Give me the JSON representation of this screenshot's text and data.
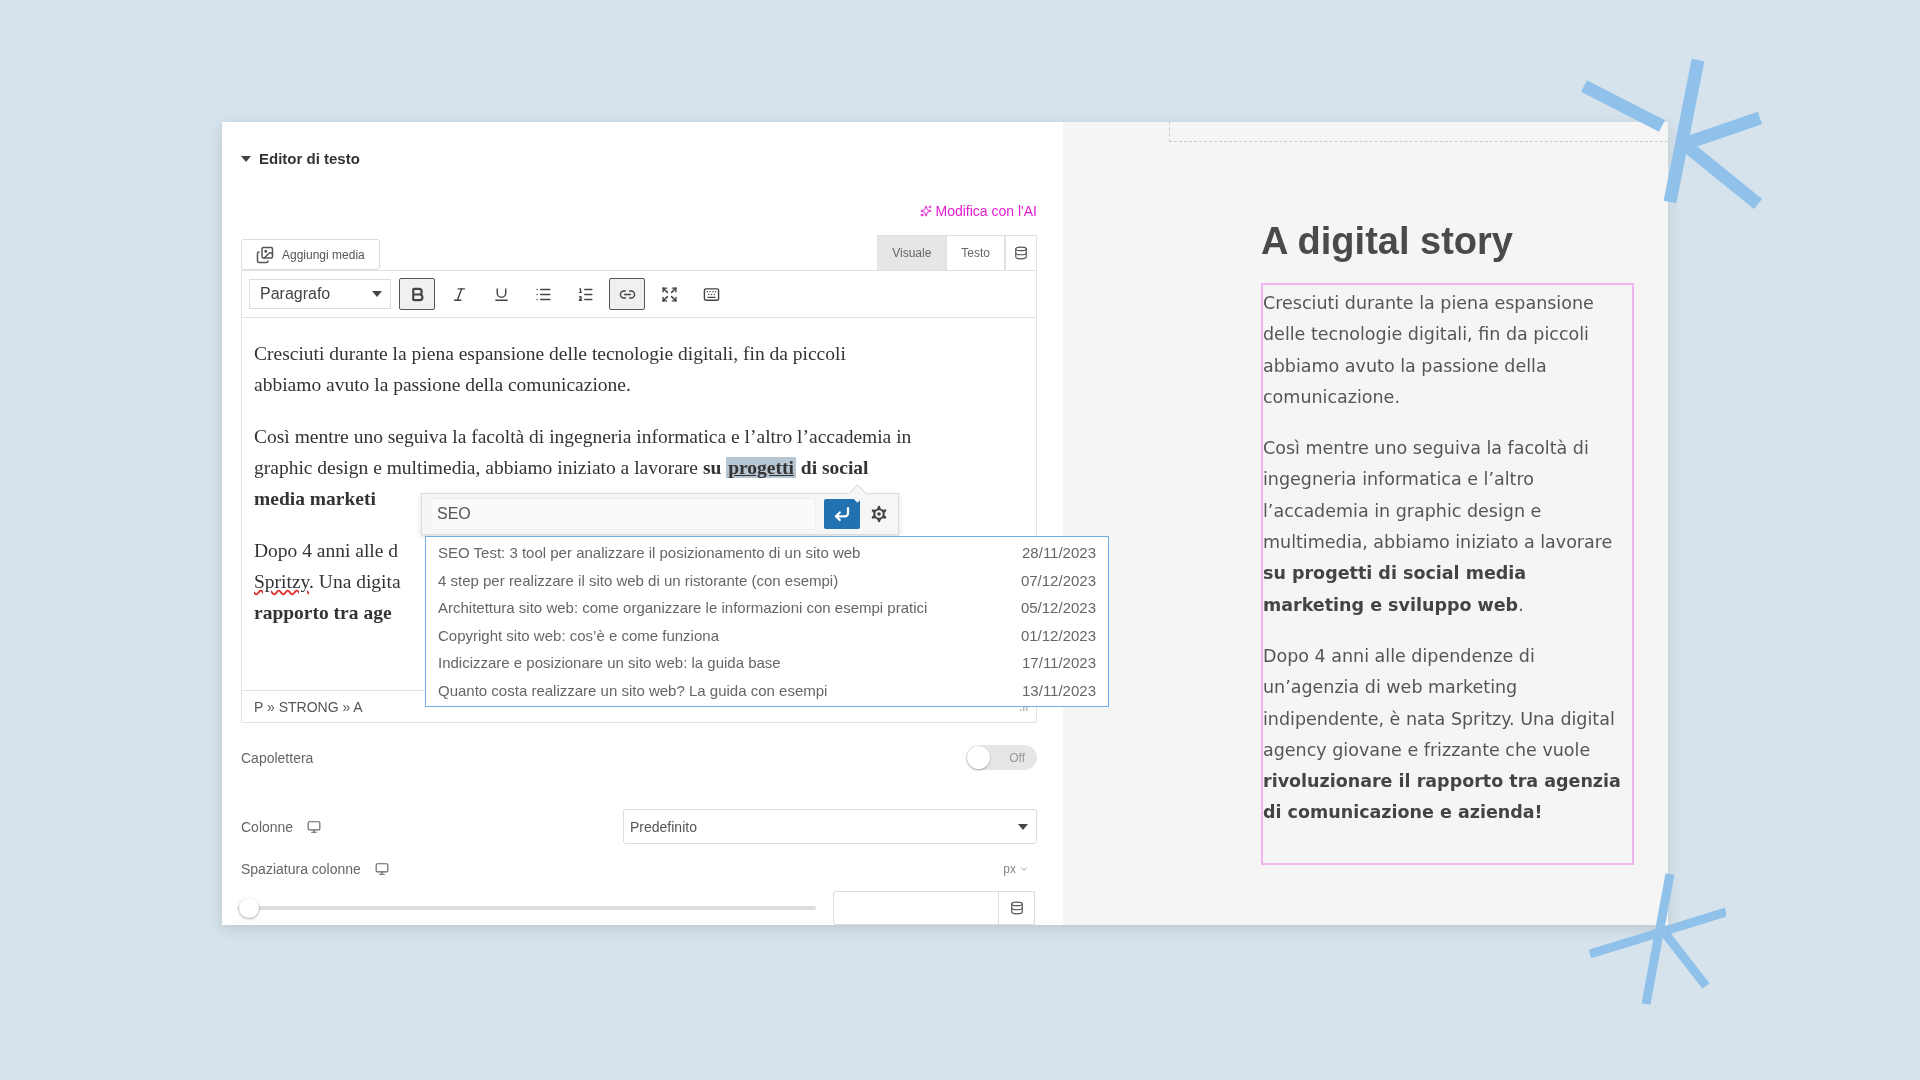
{
  "panel": {
    "section_title": "Editor di testo",
    "ai_link": "Modifica con l'AI",
    "editor": {
      "add_media": "Aggiungi media",
      "tabs": [
        {
          "label": "Visuale",
          "selected": true
        },
        {
          "label": "Testo",
          "selected": false
        }
      ],
      "format_select": "Paragrafo",
      "toolbar": [
        {
          "kind": "bold",
          "pressed": true
        },
        {
          "kind": "italic",
          "pressed": false
        },
        {
          "kind": "underline",
          "pressed": false
        },
        {
          "kind": "bullets",
          "pressed": false
        },
        {
          "kind": "numbers",
          "pressed": false
        },
        {
          "kind": "link",
          "pressed": true
        },
        {
          "kind": "fullscreen",
          "pressed": false
        },
        {
          "kind": "toolbar",
          "pressed": false
        }
      ],
      "paragraphs": [
        [
          [
            {
              "kind": "text",
              "text": "Cresciuti durante la piena espansione delle tecnologie digitali, fin da piccoli"
            }
          ],
          [
            {
              "kind": "text",
              "text": "abbiamo avuto la passione della comunicazione."
            }
          ]
        ],
        [
          [
            {
              "kind": "text",
              "text": "Così mentre uno seguiva la facoltà di ingegneria informatica e l’altro l’accademia in"
            }
          ],
          [
            {
              "kind": "text",
              "text": "graphic design e multimedia, abbiamo iniziato a lavorare "
            },
            {
              "kind": "bold",
              "text": "su "
            },
            {
              "kind": "link",
              "text": "progetti"
            },
            {
              "kind": "bold",
              "text": " di social"
            }
          ],
          [
            {
              "kind": "bold",
              "text": "media marketi"
            }
          ]
        ],
        [
          [
            {
              "kind": "text",
              "text": "Dopo 4 anni alle d"
            }
          ],
          [
            {
              "kind": "misspelled",
              "text": "Spritzy"
            },
            {
              "kind": "text",
              "text": ". Una digita"
            }
          ],
          [
            {
              "kind": "bold",
              "text": "rapporto tra age"
            }
          ]
        ]
      ],
      "link_popup": {
        "value": "SEO",
        "results": [
          {
            "title": "SEO Test: 3 tool per analizzare il posizionamento di un sito web",
            "date": "28/11/2023"
          },
          {
            "title": "4 step per realizzare il sito web di un ristorante (con esempi)",
            "date": "07/12/2023"
          },
          {
            "title": "Architettura sito web: come organizzare le informazioni con esempi pratici",
            "date": "05/12/2023"
          },
          {
            "title": "Copyright sito web: cos’è e come funziona",
            "date": "01/12/2023"
          },
          {
            "title": "Indicizzare e posizionare un sito web: la guida base",
            "date": "17/11/2023"
          },
          {
            "title": "Quanto costa realizzare un sito web? La guida con esempi",
            "date": "13/11/2023"
          }
        ]
      },
      "path": "P » STRONG » A"
    },
    "drop_cap": {
      "label": "Capolettera",
      "on": false,
      "state_text": "Off"
    },
    "columns": {
      "label": "Colonne",
      "value": "Predefinito"
    },
    "column_gap": {
      "label": "Spaziatura colonne",
      "unit": "px",
      "level": 0
    }
  },
  "preview": {
    "heading": "A digital story",
    "paragraphs": [
      "Cresciuti durante la piena espansione delle tecnologie digitali, fin da piccoli abbiamo avuto la passione della comunicazione.",
      "Così mentre uno seguiva la facoltà di ingegneria informatica e l’altro l’accademia in graphic design e multimedia, abbiamo iniziato a lavorare **su progetti di social media marketing e sviluppo web**.",
      "Dopo 4 anni alle dipendenze di un’agenzia di web marketing indipendente, è nata Spritzy. Una digital agency giovane e frizzante che vuole **rivoluzionare il rapporto tra agenzia di comunicazione e azienda!**"
    ]
  }
}
